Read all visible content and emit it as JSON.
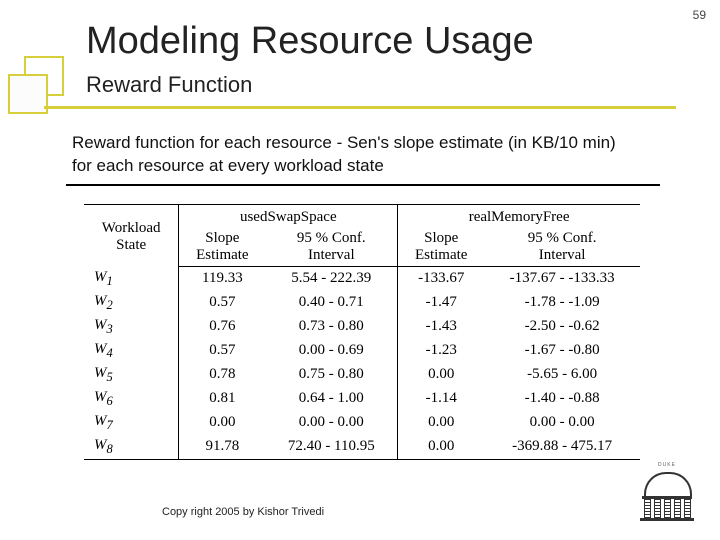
{
  "page_number": "59",
  "title": "Modeling Resource Usage",
  "subtitle": "Reward Function",
  "body": "Reward function for each resource - Sen's slope estimate (in KB/10 min) for each resource at every workload state",
  "table": {
    "col0_header_line1": "Workload",
    "col0_header_line2": "State",
    "group_a": "usedSwapSpace",
    "group_b": "realMemoryFree",
    "sub_slope_line1": "Slope",
    "sub_slope_line2": "Estimate",
    "sub_ci_line1": "95 % Conf.",
    "sub_ci_line2": "Interval",
    "rows": [
      {
        "state": "W₁",
        "a_slope": "119.33",
        "a_ci": "5.54 - 222.39",
        "b_slope": "-133.67",
        "b_ci": "-137.67 - -133.33"
      },
      {
        "state": "W₂",
        "a_slope": "0.57",
        "a_ci": "0.40 - 0.71",
        "b_slope": "-1.47",
        "b_ci": "-1.78 - -1.09"
      },
      {
        "state": "W₃",
        "a_slope": "0.76",
        "a_ci": "0.73 - 0.80",
        "b_slope": "-1.43",
        "b_ci": "-2.50 - -0.62"
      },
      {
        "state": "W₄",
        "a_slope": "0.57",
        "a_ci": "0.00 - 0.69",
        "b_slope": "-1.23",
        "b_ci": "-1.67 - -0.80"
      },
      {
        "state": "W₅",
        "a_slope": "0.78",
        "a_ci": "0.75 - 0.80",
        "b_slope": "0.00",
        "b_ci": "-5.65 - 6.00"
      },
      {
        "state": "W₆",
        "a_slope": "0.81",
        "a_ci": "0.64 - 1.00",
        "b_slope": "-1.14",
        "b_ci": "-1.40 - -0.88"
      },
      {
        "state": "W₇",
        "a_slope": "0.00",
        "a_ci": "0.00 - 0.00",
        "b_slope": "0.00",
        "b_ci": "0.00 - 0.00"
      },
      {
        "state": "W₈",
        "a_slope": "91.78",
        "a_ci": "72.40 - 110.95",
        "b_slope": "0.00",
        "b_ci": "-369.88 - 475.17"
      }
    ]
  },
  "copyright": "Copy right 2005 by Kishor Trivedi",
  "logo_label": "DUKE"
}
